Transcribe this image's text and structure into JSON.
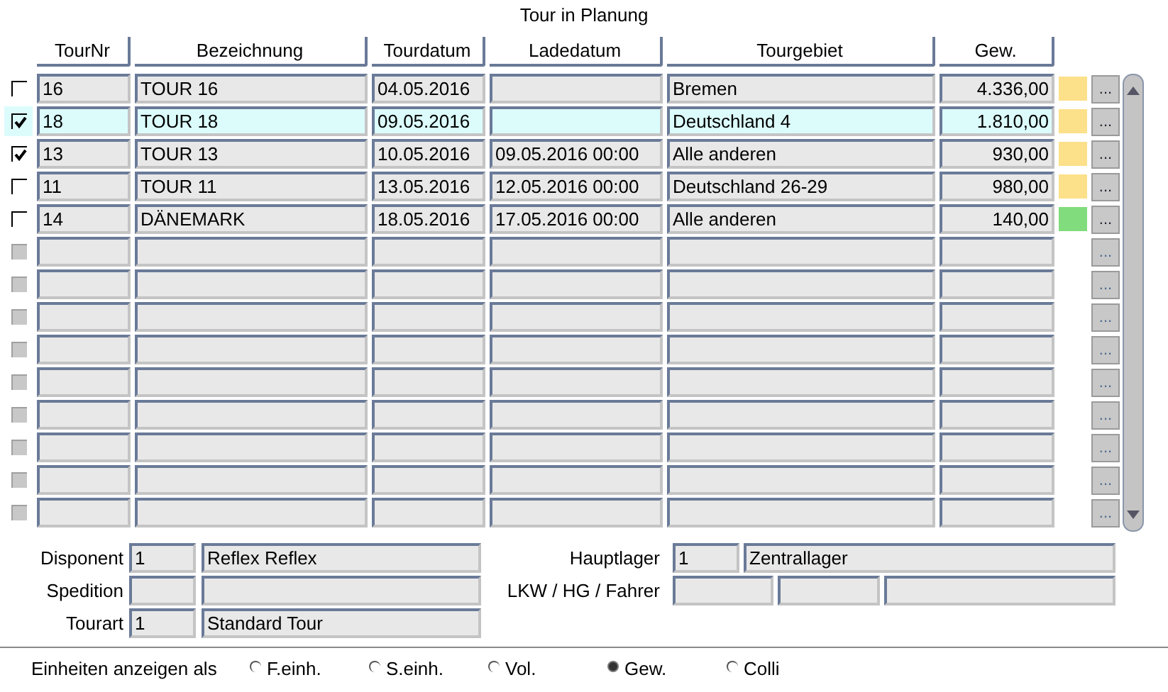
{
  "title": "Tour in Planung",
  "table": {
    "columns": [
      "TourNr",
      "Bezeichnung",
      "Tourdatum",
      "Ladedatum",
      "Tourgebiet",
      "Gew."
    ],
    "rows": [
      {
        "kind": "tour",
        "disabled": false,
        "checked": false,
        "selected": false,
        "color": "#fce08a",
        "cells": [
          "16",
          "TOUR 16",
          "04.05.2016",
          "",
          "Bremen",
          "4.336,00"
        ],
        "button": "..."
      },
      {
        "kind": "tour",
        "disabled": false,
        "checked": true,
        "selected": true,
        "color": "#fce08a",
        "cells": [
          "18",
          "TOUR 18",
          "09.05.2016",
          "",
          "Deutschland 4",
          "1.810,00"
        ],
        "button": "..."
      },
      {
        "kind": "tour",
        "disabled": false,
        "checked": true,
        "selected": false,
        "color": "#fce08a",
        "cells": [
          "13",
          "TOUR 13",
          "10.05.2016",
          "09.05.2016 00:00",
          "Alle anderen",
          "930,00"
        ],
        "button": "..."
      },
      {
        "kind": "tour",
        "disabled": false,
        "checked": false,
        "selected": false,
        "color": "#fce08a",
        "cells": [
          "11",
          "TOUR 11",
          "13.05.2016",
          "12.05.2016 00:00",
          "Deutschland 26-29",
          "980,00"
        ],
        "button": "..."
      },
      {
        "kind": "tour",
        "disabled": false,
        "checked": false,
        "selected": false,
        "color": "#80dc7c",
        "cells": [
          "14",
          "DÄNEMARK",
          "18.05.2016",
          "17.05.2016 00:00",
          "Alle anderen",
          "140,00"
        ],
        "button": "..."
      },
      {
        "kind": "empty",
        "disabled": true,
        "button": "..."
      },
      {
        "kind": "empty",
        "disabled": true,
        "button": "..."
      },
      {
        "kind": "empty",
        "disabled": true,
        "button": "..."
      },
      {
        "kind": "empty",
        "disabled": true,
        "button": "..."
      },
      {
        "kind": "empty",
        "disabled": true,
        "button": "..."
      },
      {
        "kind": "empty",
        "disabled": true,
        "button": "..."
      },
      {
        "kind": "empty",
        "disabled": true,
        "button": "..."
      },
      {
        "kind": "empty",
        "disabled": true,
        "button": "..."
      },
      {
        "kind": "empty",
        "disabled": true,
        "button": "..."
      }
    ]
  },
  "details_left": [
    {
      "label": "Disponent",
      "code": "1",
      "name": "Reflex Reflex"
    },
    {
      "label": "Spedition"
    },
    {
      "label": "Tourart",
      "code": "1",
      "name": "Standard Tour"
    }
  ],
  "details_right": [
    {
      "label": "Hauptlager",
      "kind": "two",
      "values": [
        "1",
        "Zentrallager"
      ]
    },
    {
      "label": "LKW / HG / Fahrer",
      "kind": "three"
    }
  ],
  "units": {
    "label": "Einheiten anzeigen als",
    "options": [
      {
        "label": "F.einh.",
        "selected": false
      },
      {
        "label": "S.einh.",
        "selected": false
      },
      {
        "label": "Vol.",
        "selected": false
      },
      {
        "label": "Gew.",
        "selected": true
      },
      {
        "label": "Colli",
        "selected": false
      }
    ]
  }
}
